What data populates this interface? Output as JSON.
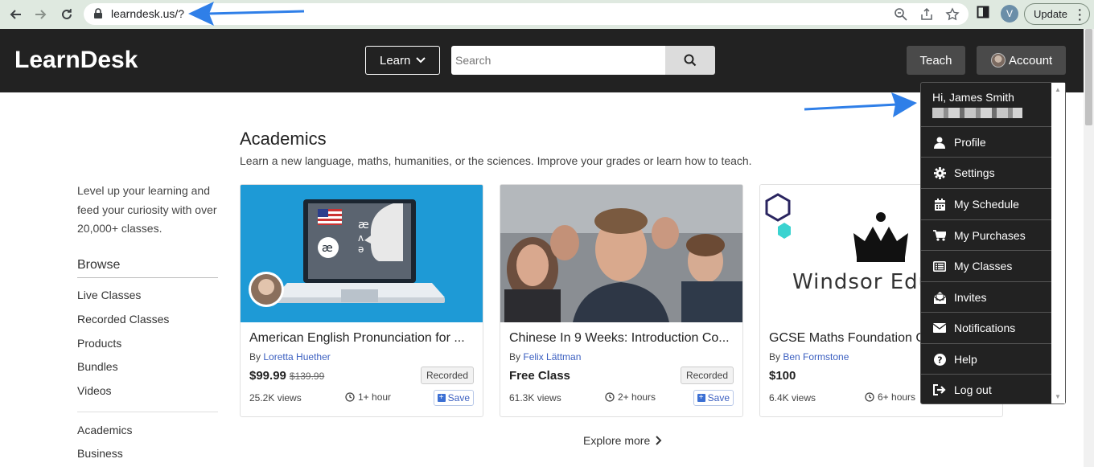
{
  "browser": {
    "url": "learndesk.us/?",
    "profile_initial": "V",
    "update_label": "Update"
  },
  "header": {
    "logo": "LearnDesk",
    "learn_label": "Learn",
    "search_placeholder": "Search",
    "teach_label": "Teach",
    "account_label": "Account"
  },
  "sidebar": {
    "tagline": "Level up your learning and feed your curiosity with over 20,000+ classes.",
    "browse_title": "Browse",
    "links": [
      "Live Classes",
      "Recorded Classes",
      "Products",
      "Bundles",
      "Videos"
    ],
    "categories": [
      "Academics",
      "Business"
    ]
  },
  "main": {
    "section_title": "Academics",
    "section_desc": "Learn a new language, maths, humanities, or the sciences. Improve your grades or learn how to teach.",
    "explore_label": "Explore more",
    "cards": [
      {
        "title": "American English Pronunciation for ...",
        "by_prefix": "By",
        "author": "Loretta Huether",
        "price": "$99.99",
        "old_price": "$139.99",
        "badge": "Recorded",
        "views": "25.2K views",
        "duration": "1+ hour",
        "save_label": "Save"
      },
      {
        "title": "Chinese In 9 Weeks: Introduction Co...",
        "by_prefix": "By",
        "author": "Felix Lättman",
        "price": "Free Class",
        "old_price": "",
        "badge": "Recorded",
        "views": "61.3K views",
        "duration": "2+ hours",
        "save_label": "Save"
      },
      {
        "title": "GCSE Maths Foundation C",
        "by_prefix": "By",
        "author": "Ben Formstone",
        "price": "$100",
        "old_price": "",
        "badge": "",
        "views": "6.4K views",
        "duration": "6+ hours",
        "save_label": "",
        "thumb_text": "Windsor Educ"
      }
    ]
  },
  "account_menu": {
    "greeting": "Hi, James Smith",
    "items": [
      "Profile",
      "Settings",
      "My Schedule",
      "My Purchases",
      "My Classes",
      "Invites",
      "Notifications",
      "Help",
      "Log out"
    ]
  },
  "colors": {
    "header_bg": "#222222",
    "link_blue": "#3b5fc0",
    "annotation_arrow": "#2f7fe8"
  }
}
